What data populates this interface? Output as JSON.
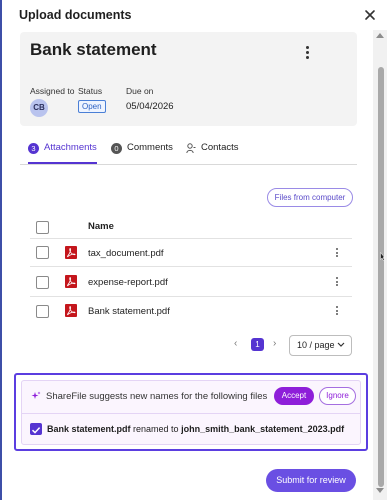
{
  "dialog": {
    "title": "Upload documents"
  },
  "task": {
    "title": "Bank statement",
    "assigned_label": "Assigned to",
    "assignee_initials": "CB",
    "status_label": "Status",
    "status_value": "Open",
    "due_label": "Due on",
    "due_value": "05/04/2026"
  },
  "tabs": [
    {
      "count": "3",
      "label": "Attachments",
      "active": true
    },
    {
      "count": "0",
      "label": "Comments",
      "active": false
    },
    {
      "label": "Contacts",
      "icon": "contacts-icon",
      "active": false
    }
  ],
  "files_button_label": "Files from computer",
  "table": {
    "column_name": "Name",
    "rows": [
      {
        "name": "tax_document.pdf",
        "icon": "pdf-icon"
      },
      {
        "name": "expense-report.pdf",
        "icon": "pdf-icon"
      },
      {
        "name": "Bank statement.pdf",
        "icon": "pdf-icon"
      }
    ]
  },
  "pagination": {
    "current_page": "1",
    "page_size": "10 / page"
  },
  "suggestion": {
    "message": "ShareFile suggests new names for the following files",
    "accept_label": "Accept",
    "ignore_label": "Ignore",
    "original_name": "Bank statement.pdf",
    "renamed_to_text": "renamed to",
    "new_name": "john_smith_bank_statement_2023.pdf"
  },
  "submit_label": "Submit for review",
  "colors": {
    "accent": "#5534d1",
    "accept": "#8e1ed9",
    "highlight_border": "#5b3ee0",
    "pdf_red": "#c4161c"
  }
}
